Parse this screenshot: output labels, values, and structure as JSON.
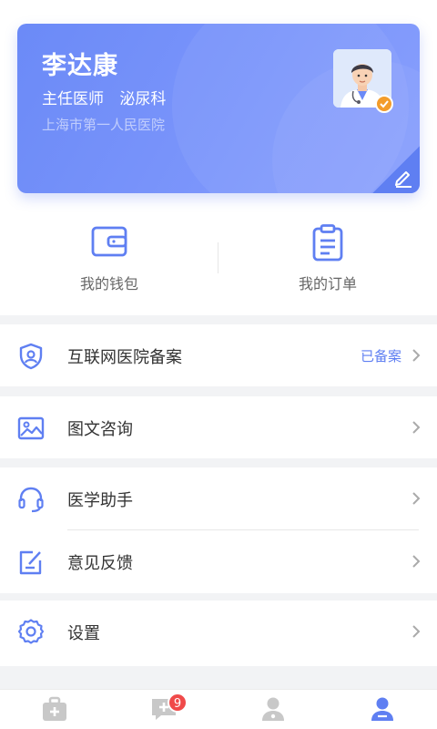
{
  "profile": {
    "name": "李达康",
    "title": "主任医师",
    "department": "泌尿科",
    "hospital": "上海市第一人民医院",
    "avatar_icon": "doctor-avatar",
    "badge_icon": "verified-badge-icon",
    "edit_icon": "pencil-icon",
    "accent_color": "#6b8af7"
  },
  "quick_actions": [
    {
      "label": "我的钱包",
      "icon": "wallet-icon"
    },
    {
      "label": "我的订单",
      "icon": "clipboard-icon"
    }
  ],
  "menu_groups": [
    [
      {
        "label": "互联网医院备案",
        "status": "已备案",
        "icon": "shield-user-icon"
      }
    ],
    [
      {
        "label": "图文咨询",
        "icon": "image-icon"
      }
    ],
    [
      {
        "label": "医学助手",
        "icon": "headset-icon"
      },
      {
        "label": "意见反馈",
        "icon": "feedback-edit-icon"
      }
    ],
    [
      {
        "label": "设置",
        "icon": "gear-icon"
      }
    ]
  ],
  "tabbar": {
    "tabs": [
      {
        "icon": "medical-kit-icon",
        "active": false
      },
      {
        "icon": "chat-plus-icon",
        "active": false,
        "badge": "9"
      },
      {
        "icon": "doctor-user-icon",
        "active": false
      },
      {
        "icon": "profile-user-icon",
        "active": true
      }
    ],
    "active_color": "#5f7ff2",
    "inactive_color": "#c8c8c8"
  }
}
